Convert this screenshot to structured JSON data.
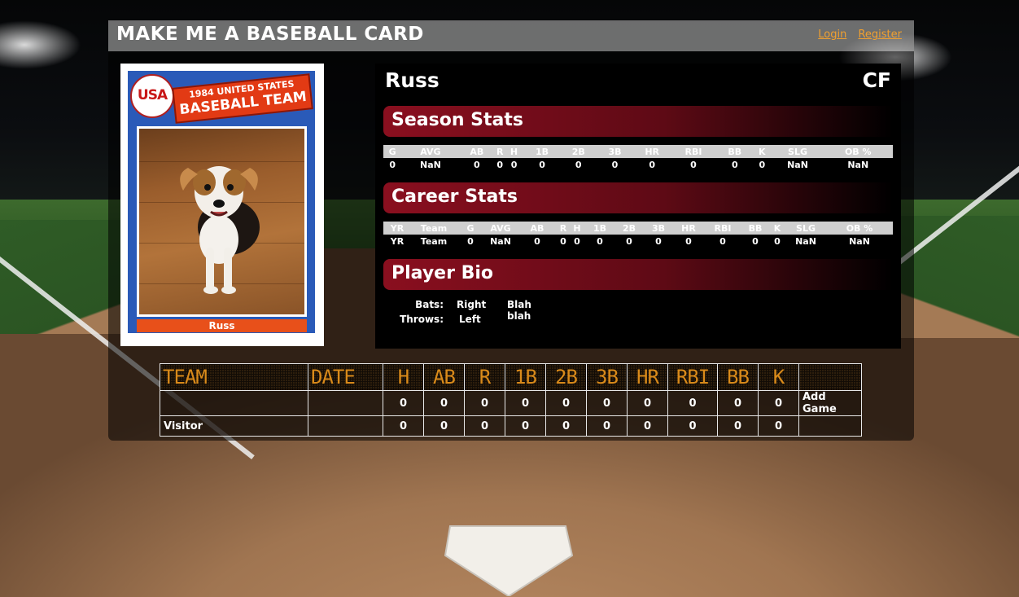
{
  "header": {
    "site_title": "MAKE ME A BASEBALL CARD",
    "login_label": "Login",
    "register_label": "Register"
  },
  "card": {
    "badge_text": "USA",
    "banner_line1": "1984 UNITED STATES",
    "banner_line2": "BASEBALL TEAM",
    "name": "Russ"
  },
  "player": {
    "name": "Russ",
    "position": "CF"
  },
  "season": {
    "title": "Season Stats",
    "headers": [
      "G",
      "AVG",
      "AB",
      "R",
      "H",
      "1B",
      "2B",
      "3B",
      "HR",
      "RBI",
      "BB",
      "K",
      "SLG",
      "OB %"
    ],
    "values": [
      "0",
      "NaN",
      "0",
      "0",
      "0",
      "0",
      "0",
      "0",
      "0",
      "0",
      "0",
      "0",
      "NaN",
      "NaN"
    ]
  },
  "career": {
    "title": "Career Stats",
    "headers": [
      "YR",
      "Team",
      "G",
      "AVG",
      "AB",
      "R",
      "H",
      "1B",
      "2B",
      "3B",
      "HR",
      "RBI",
      "BB",
      "K",
      "SLG",
      "OB %"
    ],
    "values": [
      "YR",
      "Team",
      "0",
      "NaN",
      "0",
      "0",
      "0",
      "0",
      "0",
      "0",
      "0",
      "0",
      "0",
      "0",
      "NaN",
      "NaN"
    ]
  },
  "bio": {
    "title": "Player Bio",
    "bats_label": "Bats:",
    "bats_value": "Right",
    "throws_label": "Throws:",
    "throws_value": "Left",
    "text": "Blah blah"
  },
  "scoreboard": {
    "headers": [
      "TEAM",
      "DATE",
      "H",
      "AB",
      "R",
      "1B",
      "2B",
      "3B",
      "HR",
      "RBI",
      "BB",
      "K"
    ],
    "home_row": [
      "",
      "",
      "0",
      "0",
      "0",
      "0",
      "0",
      "0",
      "0",
      "0",
      "0",
      "0"
    ],
    "visitor_row": [
      "Visitor",
      "",
      "0",
      "0",
      "0",
      "0",
      "0",
      "0",
      "0",
      "0",
      "0",
      "0"
    ],
    "add_game_label": "Add Game"
  }
}
